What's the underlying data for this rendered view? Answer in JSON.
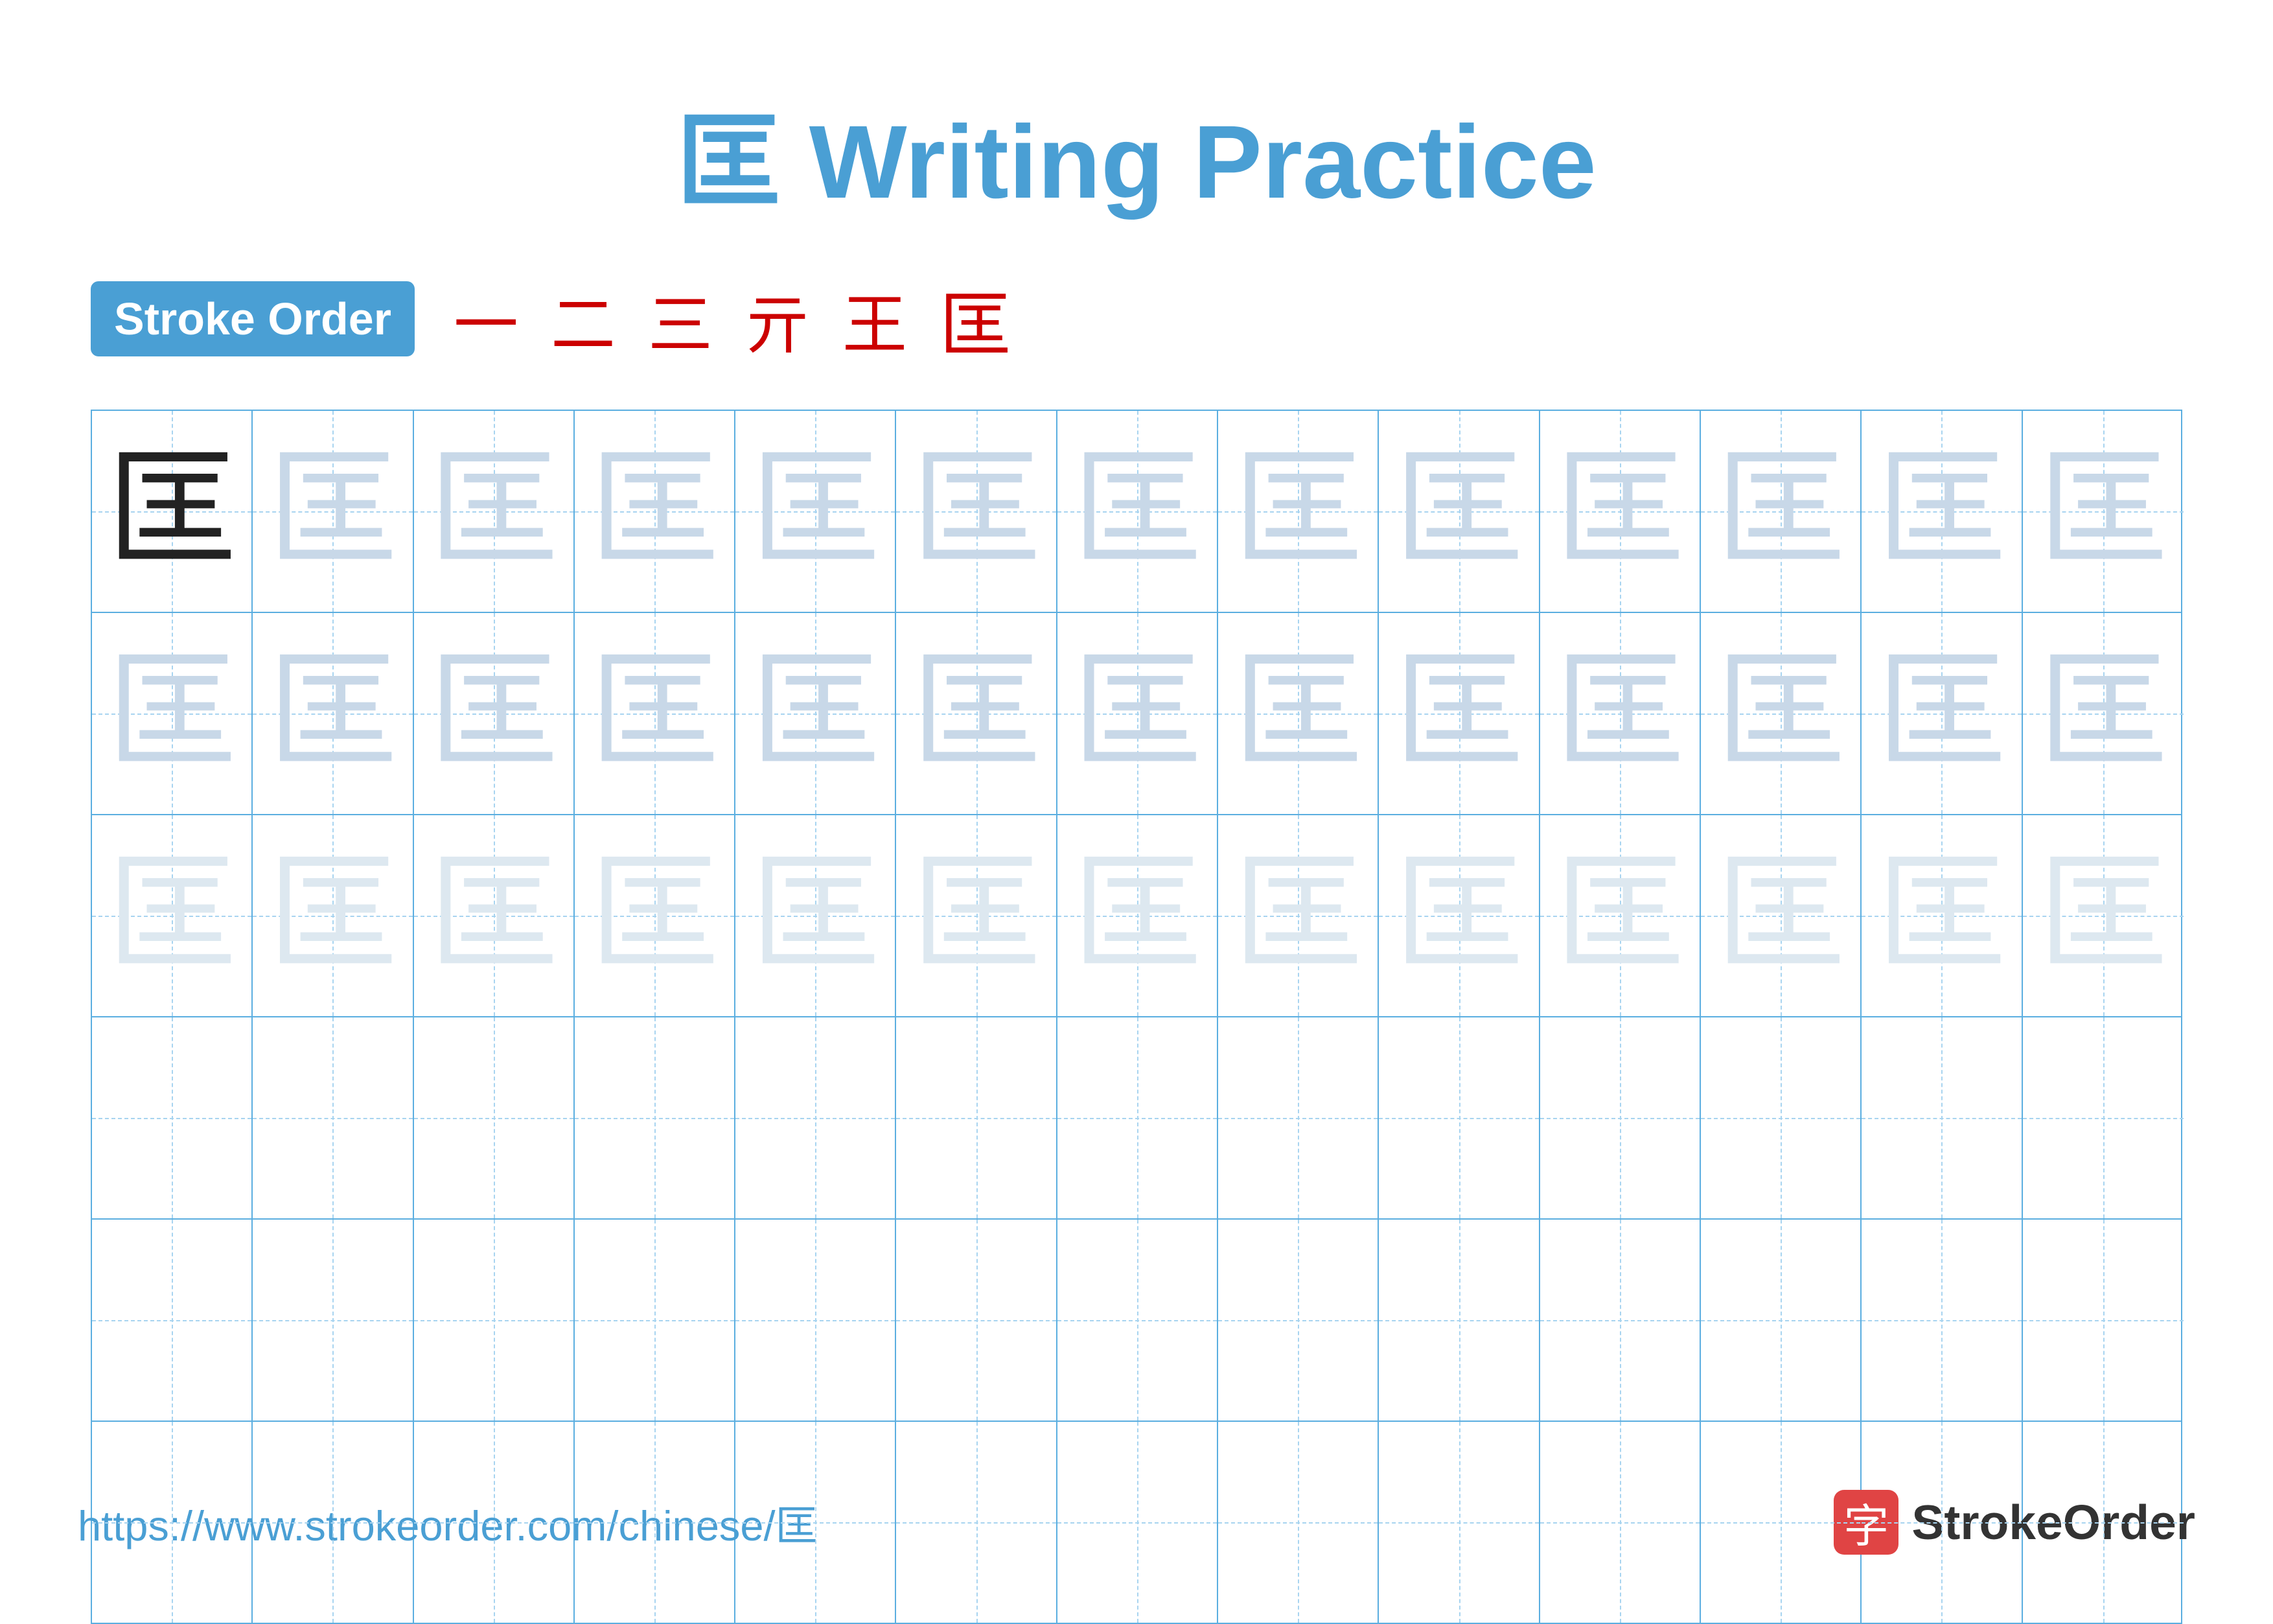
{
  "title": {
    "char": "匡",
    "label": "Writing Practice",
    "full": "匡 Writing Practice"
  },
  "stroke_order": {
    "badge_label": "Stroke Order",
    "strokes": [
      "一",
      "二",
      "三",
      "亓",
      "王",
      "匡"
    ]
  },
  "grid": {
    "rows": 6,
    "cols": 13,
    "char": "匡",
    "row_patterns": [
      "dark_then_medium",
      "medium",
      "light",
      "empty",
      "empty",
      "empty"
    ]
  },
  "footer": {
    "url": "https://www.strokeorder.com/chinese/匡",
    "logo_text": "StrokeOrder",
    "logo_icon": "字"
  }
}
